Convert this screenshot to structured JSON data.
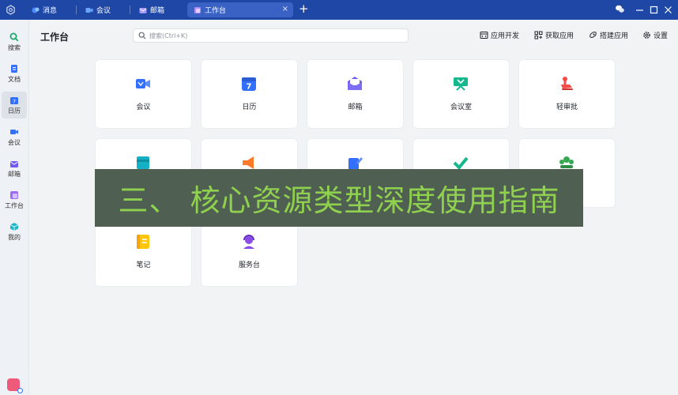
{
  "titlebar": {
    "tabs": [
      {
        "label": "消息",
        "icon": "message-icon"
      },
      {
        "label": "会议",
        "icon": "video-meeting-icon"
      },
      {
        "label": "邮箱",
        "icon": "mail-icon"
      },
      {
        "label": "工作台",
        "icon": "workplace-icon",
        "active": true
      }
    ],
    "close_glyph": "×",
    "new_tab_glyph": "+",
    "controls": [
      "minimize",
      "maximize",
      "close"
    ]
  },
  "sidebar": {
    "items": [
      {
        "label": "搜索",
        "icon": "search-icon"
      },
      {
        "label": "文档",
        "icon": "docs-icon"
      },
      {
        "label": "日历",
        "icon": "calendar-icon"
      },
      {
        "label": "会议",
        "icon": "video-meeting-icon"
      },
      {
        "label": "邮箱",
        "icon": "mail-icon"
      },
      {
        "label": "工作台",
        "icon": "workplace-icon"
      },
      {
        "label": "我的",
        "icon": "cube-icon"
      }
    ]
  },
  "header": {
    "title": "工作台",
    "search_placeholder": "搜索(Ctrl+K)",
    "tools": [
      {
        "label": "应用开发",
        "icon": "app-dev-icon"
      },
      {
        "label": "获取应用",
        "icon": "get-apps-icon"
      },
      {
        "label": "搭建应用",
        "icon": "build-app-icon"
      },
      {
        "label": "设置",
        "icon": "gear-icon"
      }
    ]
  },
  "apps": {
    "row1": [
      {
        "label": "会议",
        "icon": "video-meeting-icon",
        "color": "#3370ff"
      },
      {
        "label": "日历",
        "icon": "calendar-icon",
        "color": "#3370ff"
      },
      {
        "label": "邮箱",
        "icon": "mail-icon",
        "color": "#7b67ee"
      },
      {
        "label": "会议室",
        "icon": "meeting-room-icon",
        "color": "#14b88c"
      },
      {
        "label": "轻审批",
        "icon": "stamp-icon",
        "color": "#f54a45"
      }
    ],
    "row3": [
      {
        "label": "笔记",
        "icon": "notebook-icon",
        "color": "#ffc60a"
      },
      {
        "label": "服务台",
        "icon": "helpdesk-icon",
        "color": "#8a4ee6"
      }
    ]
  },
  "banner": {
    "text": "三、 核心资源类型深度使用指南"
  }
}
